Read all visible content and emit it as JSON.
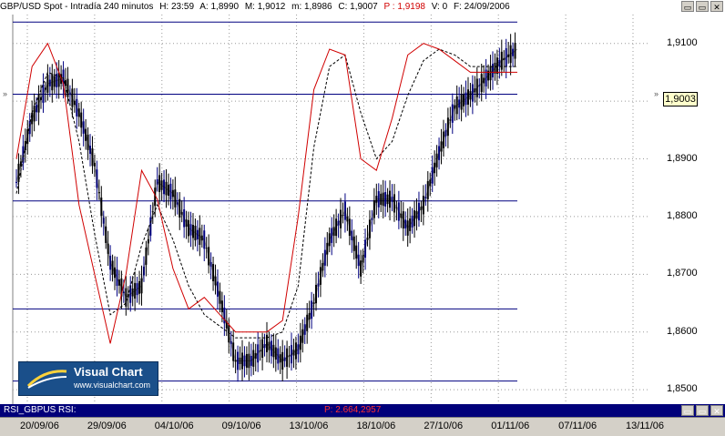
{
  "header": {
    "symbol": "GBP/USD Spot - Intradía 240 minutos",
    "h_label": "H: 23:59",
    "a_label": "A: 1,8990",
    "max_label": "M: 1,9012",
    "min_label": "m: 1,8986",
    "c_label": "C: 1,9007",
    "p_label": "P : 1,9198",
    "v_label": "V: 0",
    "f_label": "F: 24/09/2006",
    "win_buttons": [
      "▭",
      "▭",
      "✕"
    ]
  },
  "price_axis": {
    "last_price": "1,9003",
    "tick_labels": [
      "1,9100",
      "1,9000",
      "1,8900",
      "1,8800",
      "1,8700",
      "1,8600",
      "1,8500"
    ]
  },
  "rsi_bar": {
    "label": "RSI_GBPUS  RSI:",
    "p_value": "P: 2.664,2957",
    "win_buttons": [
      "▭",
      "▭",
      "✕"
    ]
  },
  "date_axis": {
    "labels": [
      "20/09/06",
      "29/09/06",
      "04/10/06",
      "09/10/06",
      "13/10/06",
      "18/10/06",
      "27/10/06",
      "01/11/06",
      "07/11/06",
      "13/11/06"
    ]
  },
  "logo": {
    "name": "Visual Chart",
    "url": "www.visualchart.com"
  },
  "colors": {
    "plot_bg": "#ffffff",
    "candle": "#000000",
    "candle_alt": "#000080",
    "fast_ma": "#d00000",
    "slow_ma": "#000000",
    "level_lines": "#000080",
    "rsi_bar_bg": "#00007a"
  },
  "chart_data": {
    "type": "line",
    "title": "GBP/USD Spot - Intradía 240 minutos",
    "y_range": [
      1.8475,
      1.915
    ],
    "x": [
      "20/09/06",
      "29/09/06",
      "04/10/06",
      "09/10/06",
      "13/10/06",
      "18/10/06",
      "27/10/06",
      "01/11/06",
      "07/11/06",
      "13/11/06"
    ],
    "last_price": 1.9003,
    "horizontal_levels": [
      1.9137,
      1.9012,
      1.8827,
      1.864,
      1.8515
    ],
    "series": [
      {
        "name": "",
        "kind": "price",
        "values": [
          1.886,
          1.897,
          1.903,
          1.904,
          1.898,
          1.889,
          1.872,
          1.866,
          1.868,
          1.886,
          1.884,
          1.878,
          1.876,
          1.866,
          1.855,
          1.855,
          1.858,
          1.855,
          1.857,
          1.865,
          1.876,
          1.881,
          1.871,
          1.883,
          1.883,
          1.878,
          1.882,
          1.891,
          1.899,
          1.901,
          1.904,
          1.907,
          1.909
        ]
      },
      {
        "name": "",
        "kind": "fast_ma",
        "values": [
          1.89,
          1.906,
          1.91,
          1.903,
          1.882,
          1.87,
          1.858,
          1.87,
          1.888,
          1.883,
          1.871,
          1.864,
          1.866,
          1.863,
          1.86,
          1.86,
          1.86,
          1.862,
          1.88,
          1.902,
          1.909,
          1.908,
          1.89,
          1.888,
          1.897,
          1.908,
          1.91,
          1.909,
          1.907,
          1.905,
          1.905,
          1.905,
          1.905
        ]
      },
      {
        "name": "",
        "kind": "slow_ma",
        "values": [
          1.884,
          1.898,
          1.905,
          1.904,
          1.893,
          1.877,
          1.863,
          1.865,
          1.875,
          1.882,
          1.876,
          1.868,
          1.863,
          1.861,
          1.859,
          1.859,
          1.859,
          1.86,
          1.868,
          1.892,
          1.906,
          1.908,
          1.898,
          1.89,
          1.893,
          1.901,
          1.907,
          1.909,
          1.908,
          1.906,
          1.906,
          1.906,
          1.906
        ]
      }
    ],
    "grid": true
  }
}
